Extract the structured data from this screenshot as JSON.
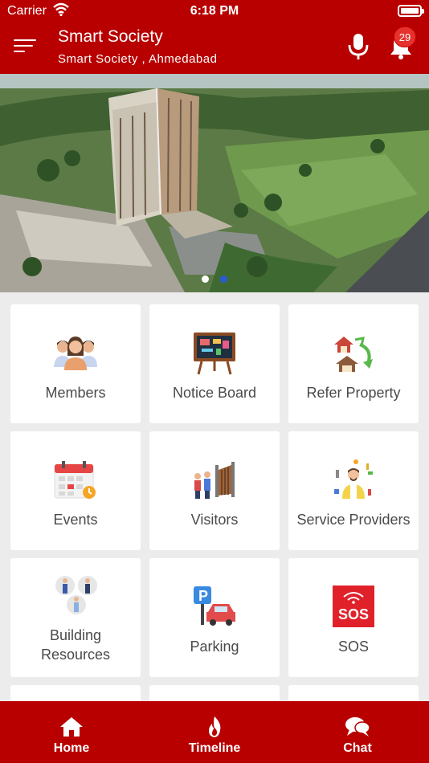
{
  "status_bar": {
    "carrier": "Carrier",
    "time": "6:18 PM"
  },
  "app_bar": {
    "title": "Smart Society",
    "subtitle": "Smart  Society ,  Ahmedabad",
    "notification_count": "29"
  },
  "banner": {
    "slide_count": 2,
    "active_slide": 1
  },
  "grid": {
    "tiles": [
      {
        "label": "Members",
        "icon": "members-icon"
      },
      {
        "label": "Notice Board",
        "icon": "notice-board-icon"
      },
      {
        "label": "Refer Property",
        "icon": "refer-property-icon"
      },
      {
        "label": "Events",
        "icon": "calendar-icon"
      },
      {
        "label": "Visitors",
        "icon": "visitors-icon"
      },
      {
        "label": "Service Providers",
        "icon": "service-provider-icon"
      },
      {
        "label_line1": "Building",
        "label_line2": "Resources",
        "icon": "building-resources-icon"
      },
      {
        "label": "Parking",
        "icon": "parking-icon"
      },
      {
        "label": "SOS",
        "icon": "sos-icon",
        "icon_text": "SOS"
      }
    ]
  },
  "bottom_nav": {
    "items": [
      {
        "label": "Home",
        "icon": "home-icon"
      },
      {
        "label": "Timeline",
        "icon": "flame-icon"
      },
      {
        "label": "Chat",
        "icon": "chat-icon"
      }
    ]
  },
  "colors": {
    "brand": "#b80000",
    "background": "#ececec",
    "tile": "#ffffff",
    "label": "#4a4a4a"
  }
}
